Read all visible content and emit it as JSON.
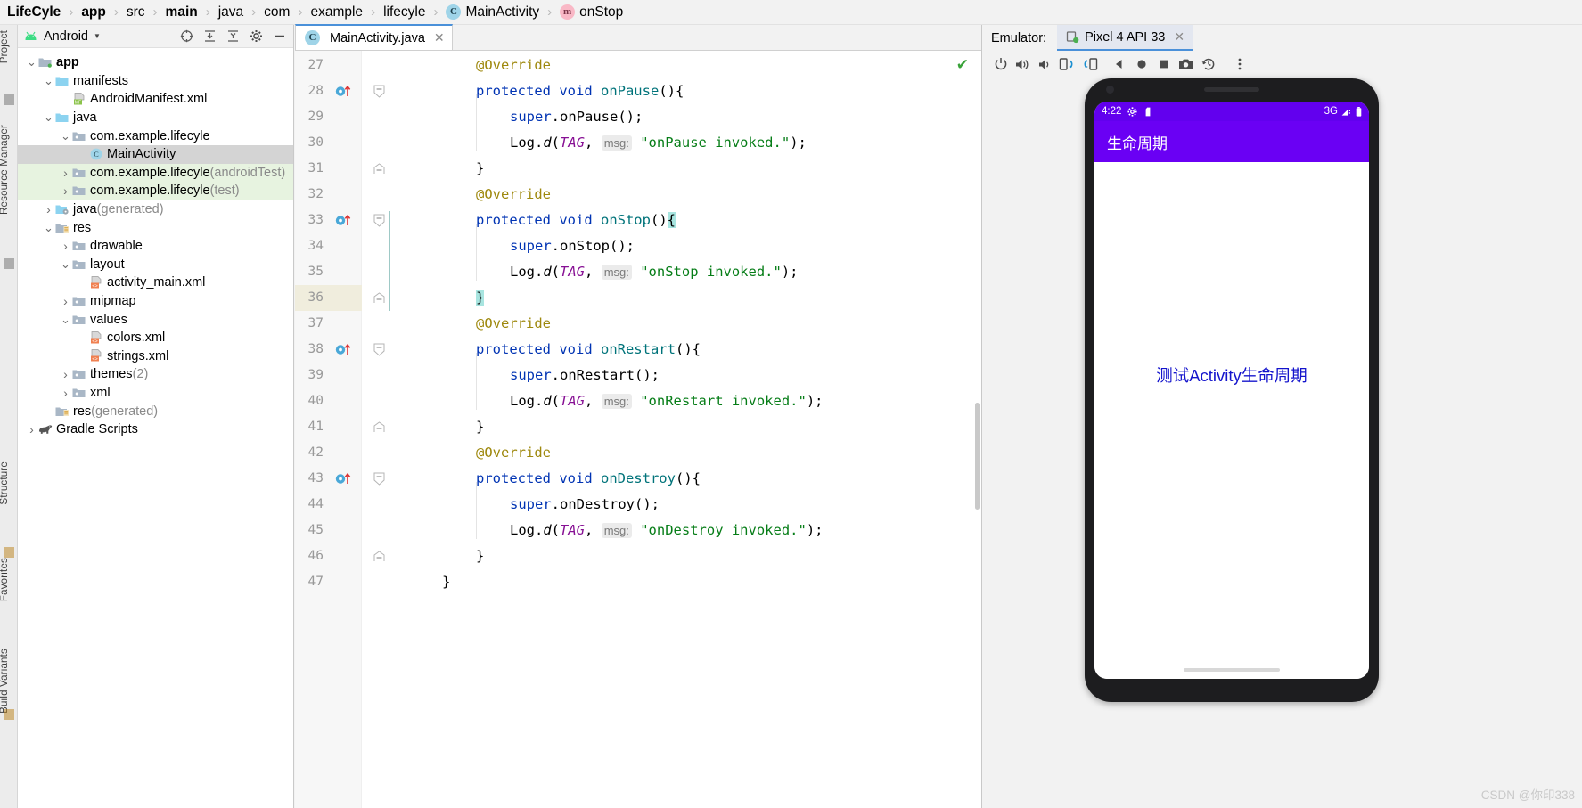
{
  "breadcrumb": {
    "items": [
      {
        "label": "LifeCyle",
        "bold": true,
        "icon": null
      },
      {
        "label": "app",
        "bold": true,
        "icon": null
      },
      {
        "label": "src",
        "bold": false,
        "icon": null
      },
      {
        "label": "main",
        "bold": true,
        "icon": null
      },
      {
        "label": "java",
        "bold": false,
        "icon": null
      },
      {
        "label": "com",
        "bold": false,
        "icon": null
      },
      {
        "label": "example",
        "bold": false,
        "icon": null
      },
      {
        "label": "lifecyle",
        "bold": false,
        "icon": null
      },
      {
        "label": "MainActivity",
        "bold": false,
        "icon": "class-icon"
      },
      {
        "label": "onStop",
        "bold": false,
        "icon": "method-icon"
      }
    ],
    "separator": "›",
    "class_icon_letter": "C",
    "method_icon_letter": "m"
  },
  "left_rail": {
    "items": [
      {
        "label": "Project",
        "name": "rail-project"
      },
      {
        "label": "Resource Manager",
        "name": "rail-resource-manager"
      },
      {
        "label": "Structure",
        "name": "rail-structure"
      },
      {
        "label": "Favorites",
        "name": "rail-favorites"
      },
      {
        "label": "Build Variants",
        "name": "rail-build-variants"
      }
    ]
  },
  "project_panel": {
    "title": "Android",
    "dropdown_arrow": "▼",
    "toolbar_icons": [
      "target-icon",
      "expand-all-icon",
      "collapse-all-icon",
      "gear-icon",
      "minimize-icon"
    ],
    "tree": [
      {
        "indent": 0,
        "arrow": "v",
        "icon": "module-folder-icon",
        "label": "app",
        "suffix": "",
        "bold": true,
        "selected": false,
        "test": false
      },
      {
        "indent": 1,
        "arrow": "v",
        "icon": "folder-blue-icon",
        "label": "manifests",
        "suffix": "",
        "bold": false,
        "selected": false,
        "test": false
      },
      {
        "indent": 2,
        "arrow": "",
        "icon": "manifest-file-icon",
        "label": "AndroidManifest.xml",
        "suffix": "",
        "bold": false,
        "selected": false,
        "test": false
      },
      {
        "indent": 1,
        "arrow": "v",
        "icon": "folder-blue-icon",
        "label": "java",
        "suffix": "",
        "bold": false,
        "selected": false,
        "test": false
      },
      {
        "indent": 2,
        "arrow": "v",
        "icon": "package-icon",
        "label": "com.example.lifecyle",
        "suffix": "",
        "bold": false,
        "selected": false,
        "test": false
      },
      {
        "indent": 3,
        "arrow": "",
        "icon": "class-icon",
        "label": "MainActivity",
        "suffix": "",
        "bold": false,
        "selected": true,
        "test": false
      },
      {
        "indent": 2,
        "arrow": ">",
        "icon": "package-icon",
        "label": "com.example.lifecyle",
        "suffix": "(androidTest)",
        "bold": false,
        "selected": false,
        "test": true
      },
      {
        "indent": 2,
        "arrow": ">",
        "icon": "package-icon",
        "label": "com.example.lifecyle",
        "suffix": "(test)",
        "bold": false,
        "selected": false,
        "test": true
      },
      {
        "indent": 1,
        "arrow": ">",
        "icon": "generated-folder-icon",
        "label": "java",
        "suffix": "(generated)",
        "bold": false,
        "selected": false,
        "test": false
      },
      {
        "indent": 1,
        "arrow": "v",
        "icon": "res-folder-icon",
        "label": "res",
        "suffix": "",
        "bold": false,
        "selected": false,
        "test": false
      },
      {
        "indent": 2,
        "arrow": ">",
        "icon": "package-icon",
        "label": "drawable",
        "suffix": "",
        "bold": false,
        "selected": false,
        "test": false
      },
      {
        "indent": 2,
        "arrow": "v",
        "icon": "package-icon",
        "label": "layout",
        "suffix": "",
        "bold": false,
        "selected": false,
        "test": false
      },
      {
        "indent": 3,
        "arrow": "",
        "icon": "xml-file-icon",
        "label": "activity_main.xml",
        "suffix": "",
        "bold": false,
        "selected": false,
        "test": false
      },
      {
        "indent": 2,
        "arrow": ">",
        "icon": "package-icon",
        "label": "mipmap",
        "suffix": "",
        "bold": false,
        "selected": false,
        "test": false
      },
      {
        "indent": 2,
        "arrow": "v",
        "icon": "package-icon",
        "label": "values",
        "suffix": "",
        "bold": false,
        "selected": false,
        "test": false
      },
      {
        "indent": 3,
        "arrow": "",
        "icon": "xml-file-icon",
        "label": "colors.xml",
        "suffix": "",
        "bold": false,
        "selected": false,
        "test": false
      },
      {
        "indent": 3,
        "arrow": "",
        "icon": "xml-file-icon",
        "label": "strings.xml",
        "suffix": "",
        "bold": false,
        "selected": false,
        "test": false
      },
      {
        "indent": 2,
        "arrow": ">",
        "icon": "package-icon",
        "label": "themes",
        "suffix": "(2)",
        "bold": false,
        "selected": false,
        "test": false
      },
      {
        "indent": 2,
        "arrow": ">",
        "icon": "package-icon",
        "label": "xml",
        "suffix": "",
        "bold": false,
        "selected": false,
        "test": false
      },
      {
        "indent": 1,
        "arrow": "",
        "icon": "generated-res-icon",
        "label": "res",
        "suffix": "(generated)",
        "bold": false,
        "selected": false,
        "test": false
      },
      {
        "indent": 0,
        "arrow": ">",
        "icon": "gradle-icon",
        "label": "Gradle Scripts",
        "suffix": "",
        "bold": false,
        "selected": false,
        "test": false
      }
    ]
  },
  "editor": {
    "tab": {
      "label": "MainActivity.java",
      "icon": "class-icon",
      "close": "✕"
    },
    "inspection_status": "✔",
    "current_line": 36,
    "first_line": 27,
    "lines": [
      {
        "n": 27,
        "indent": 1,
        "fold": "",
        "marker": "",
        "tokens": [
          {
            "t": "@Override",
            "c": "k-ann"
          }
        ]
      },
      {
        "n": 28,
        "indent": 1,
        "fold": "minus",
        "marker": "override",
        "tokens": [
          {
            "t": "protected void ",
            "c": "k-kw"
          },
          {
            "t": "onPause",
            "c": "k-meth"
          },
          {
            "t": "(){",
            "c": "k-plain"
          }
        ]
      },
      {
        "n": 29,
        "indent": 2,
        "fold": "",
        "marker": "",
        "tokens": [
          {
            "t": "super",
            "c": "k-kw"
          },
          {
            "t": ".onPause();",
            "c": "k-plain"
          }
        ]
      },
      {
        "n": 30,
        "indent": 2,
        "fold": "",
        "marker": "",
        "tokens": [
          {
            "t": "Log.",
            "c": "k-plain"
          },
          {
            "t": "d",
            "c": "k-meth-i"
          },
          {
            "t": "(",
            "c": "k-plain"
          },
          {
            "t": "TAG",
            "c": "k-field"
          },
          {
            "t": ", ",
            "c": "k-plain"
          },
          {
            "t": "msg:",
            "c": "hint"
          },
          {
            "t": " ",
            "c": "k-plain"
          },
          {
            "t": "\"onPause invoked.\"",
            "c": "k-str"
          },
          {
            "t": ");",
            "c": "k-plain"
          }
        ]
      },
      {
        "n": 31,
        "indent": 1,
        "fold": "end",
        "marker": "",
        "tokens": [
          {
            "t": "}",
            "c": "k-plain"
          }
        ]
      },
      {
        "n": 32,
        "indent": 1,
        "fold": "",
        "marker": "",
        "tokens": [
          {
            "t": "@Override",
            "c": "k-ann"
          }
        ]
      },
      {
        "n": 33,
        "indent": 1,
        "fold": "minus",
        "marker": "override",
        "tokens": [
          {
            "t": "protected void ",
            "c": "k-kw"
          },
          {
            "t": "onStop",
            "c": "k-meth"
          },
          {
            "t": "()",
            "c": "k-plain"
          },
          {
            "t": "{",
            "c": "brace"
          }
        ]
      },
      {
        "n": 34,
        "indent": 2,
        "fold": "",
        "marker": "",
        "tokens": [
          {
            "t": "super",
            "c": "k-kw"
          },
          {
            "t": ".onStop();",
            "c": "k-plain"
          }
        ]
      },
      {
        "n": 35,
        "indent": 2,
        "fold": "",
        "marker": "",
        "tokens": [
          {
            "t": "Log.",
            "c": "k-plain"
          },
          {
            "t": "d",
            "c": "k-meth-i"
          },
          {
            "t": "(",
            "c": "k-plain"
          },
          {
            "t": "TAG",
            "c": "k-field"
          },
          {
            "t": ", ",
            "c": "k-plain"
          },
          {
            "t": "msg:",
            "c": "hint"
          },
          {
            "t": " ",
            "c": "k-plain"
          },
          {
            "t": "\"onStop invoked.\"",
            "c": "k-str"
          },
          {
            "t": ");",
            "c": "k-plain"
          }
        ]
      },
      {
        "n": 36,
        "indent": 1,
        "fold": "end",
        "marker": "",
        "tokens": [
          {
            "t": "}",
            "c": "brace"
          }
        ]
      },
      {
        "n": 37,
        "indent": 1,
        "fold": "",
        "marker": "",
        "tokens": [
          {
            "t": "@Override",
            "c": "k-ann"
          }
        ]
      },
      {
        "n": 38,
        "indent": 1,
        "fold": "minus",
        "marker": "override",
        "tokens": [
          {
            "t": "protected void ",
            "c": "k-kw"
          },
          {
            "t": "onRestart",
            "c": "k-meth"
          },
          {
            "t": "(){",
            "c": "k-plain"
          }
        ]
      },
      {
        "n": 39,
        "indent": 2,
        "fold": "",
        "marker": "",
        "tokens": [
          {
            "t": "super",
            "c": "k-kw"
          },
          {
            "t": ".onRestart();",
            "c": "k-plain"
          }
        ]
      },
      {
        "n": 40,
        "indent": 2,
        "fold": "",
        "marker": "",
        "tokens": [
          {
            "t": "Log.",
            "c": "k-plain"
          },
          {
            "t": "d",
            "c": "k-meth-i"
          },
          {
            "t": "(",
            "c": "k-plain"
          },
          {
            "t": "TAG",
            "c": "k-field"
          },
          {
            "t": ", ",
            "c": "k-plain"
          },
          {
            "t": "msg:",
            "c": "hint"
          },
          {
            "t": " ",
            "c": "k-plain"
          },
          {
            "t": "\"onRestart invoked.\"",
            "c": "k-str"
          },
          {
            "t": ");",
            "c": "k-plain"
          }
        ]
      },
      {
        "n": 41,
        "indent": 1,
        "fold": "end",
        "marker": "",
        "tokens": [
          {
            "t": "}",
            "c": "k-plain"
          }
        ]
      },
      {
        "n": 42,
        "indent": 1,
        "fold": "",
        "marker": "",
        "tokens": [
          {
            "t": "@Override",
            "c": "k-ann"
          }
        ]
      },
      {
        "n": 43,
        "indent": 1,
        "fold": "minus",
        "marker": "override",
        "tokens": [
          {
            "t": "protected void ",
            "c": "k-kw"
          },
          {
            "t": "onDestroy",
            "c": "k-meth"
          },
          {
            "t": "(){",
            "c": "k-plain"
          }
        ]
      },
      {
        "n": 44,
        "indent": 2,
        "fold": "",
        "marker": "",
        "tokens": [
          {
            "t": "super",
            "c": "k-kw"
          },
          {
            "t": ".onDestroy();",
            "c": "k-plain"
          }
        ]
      },
      {
        "n": 45,
        "indent": 2,
        "fold": "",
        "marker": "",
        "tokens": [
          {
            "t": "Log.",
            "c": "k-plain"
          },
          {
            "t": "d",
            "c": "k-meth-i"
          },
          {
            "t": "(",
            "c": "k-plain"
          },
          {
            "t": "TAG",
            "c": "k-field"
          },
          {
            "t": ", ",
            "c": "k-plain"
          },
          {
            "t": "msg:",
            "c": "hint"
          },
          {
            "t": " ",
            "c": "k-plain"
          },
          {
            "t": "\"onDestroy invoked.\"",
            "c": "k-str"
          },
          {
            "t": ");",
            "c": "k-plain"
          }
        ]
      },
      {
        "n": 46,
        "indent": 1,
        "fold": "end",
        "marker": "",
        "tokens": [
          {
            "t": "}",
            "c": "k-plain"
          }
        ]
      },
      {
        "n": 47,
        "indent": 0,
        "fold": "",
        "marker": "",
        "tokens": [
          {
            "t": "}",
            "c": "k-plain"
          }
        ]
      }
    ]
  },
  "emulator": {
    "panel_label": "Emulator:",
    "tab": {
      "label": "Pixel 4 API 33",
      "icon": "device-icon",
      "close": "✕"
    },
    "toolbar": [
      {
        "name": "power-button-icon",
        "glyph": "power"
      },
      {
        "name": "volume-up-icon",
        "glyph": "vol-up"
      },
      {
        "name": "volume-down-icon",
        "glyph": "vol-down"
      },
      {
        "name": "rotate-left-icon",
        "glyph": "rot-left"
      },
      {
        "name": "rotate-right-icon",
        "glyph": "rot-right"
      },
      {
        "name": "back-button-icon",
        "glyph": "back"
      },
      {
        "name": "home-button-icon",
        "glyph": "home"
      },
      {
        "name": "overview-button-icon",
        "glyph": "overview"
      },
      {
        "name": "screenshot-icon",
        "glyph": "camera"
      },
      {
        "name": "snapshot-history-icon",
        "glyph": "history"
      },
      {
        "name": "more-options-icon",
        "glyph": "more"
      }
    ],
    "device_screen": {
      "status_bar": {
        "time": "4:22",
        "left_icons": [
          "gear-icon",
          "sd-card-icon"
        ],
        "network": "3G",
        "right_icons": [
          "signal-icon",
          "battery-icon"
        ]
      },
      "app_bar_title": "生命周期",
      "body_text": "测试Activity生命周期",
      "colors": {
        "status_bar": "#6200EE",
        "app_bar": "#6a00f4",
        "body_text": "#1414cc",
        "background": "#ffffff"
      }
    }
  },
  "watermark": "CSDN @你印338"
}
